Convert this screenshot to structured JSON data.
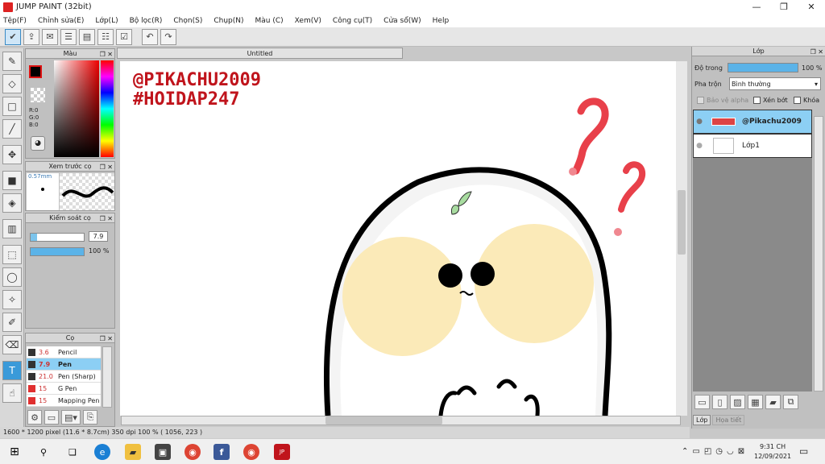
{
  "window": {
    "title": "JUMP PAINT (32bit)",
    "controls": [
      "—",
      "❐",
      "✕"
    ]
  },
  "menu": [
    "Tệp(F)",
    "Chỉnh sửa(E)",
    "Lớp(L)",
    "Bộ lọc(R)",
    "Chọn(S)",
    "Chụp(N)",
    "Màu (C)",
    "Xem(V)",
    "Công cụ(T)",
    "Cửa sổ(W)",
    "Help"
  ],
  "colors": {
    "accent": "#3a9ad9",
    "panel": "#c0c0c0",
    "tagRed": "#c0141c"
  },
  "color_panel": {
    "title": "Màu",
    "r": "R:0",
    "g": "G:0",
    "b": "B:0"
  },
  "brush_preview": {
    "title": "Xem trước cọ",
    "size": "0.57mm"
  },
  "brush_control": {
    "title": "Kiểm soát cọ",
    "size_value": "7.9",
    "opacity_value": "100 %"
  },
  "brush_list": {
    "title": "Cọ",
    "items": [
      {
        "size": "3.6",
        "name": "Pencil",
        "color": "#333333"
      },
      {
        "size": "7.9",
        "name": "Pen",
        "color": "#333333",
        "selected": true
      },
      {
        "size": "21.0",
        "name": "Pen (Sharp)",
        "color": "#333333"
      },
      {
        "size": "15",
        "name": "G Pen",
        "color": "#e03030"
      },
      {
        "size": "15",
        "name": "Mapping Pen",
        "color": "#e03030"
      }
    ]
  },
  "canvas": {
    "tab": "Untitled",
    "watermark1": "@PIKACHU2009",
    "watermark2": "#HOIDAP247"
  },
  "status": {
    "text": "1600 * 1200 pixel   (11.6 * 8.7cm)   350 dpi   100 %   ( 1056, 223 )"
  },
  "layer_panel": {
    "title": "Lớp",
    "opacity_label": "Độ trong",
    "opacity_value": "100 %",
    "blend_label": "Pha trộn",
    "blend_value": "Bình thường",
    "protect_alpha": "Bảo vệ alpha",
    "clipping": "Xén bớt",
    "lock": "Khóa",
    "layers": [
      {
        "name": "@Pikachu2009",
        "selected": true
      },
      {
        "name": "Lớp1",
        "selected": false
      }
    ],
    "tab_layer": "Lớp",
    "tab_texture": "Họa tiết"
  },
  "taskbar": {
    "time": "9:31 CH",
    "date": "12/09/2021"
  }
}
